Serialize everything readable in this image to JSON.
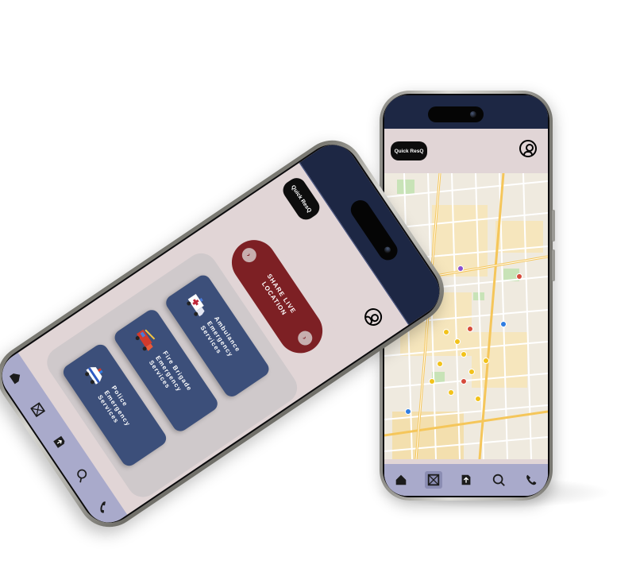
{
  "app": {
    "brand": "Quick ResQ"
  },
  "right_phone": {
    "header": {
      "brand_label": "Quick ResQ"
    },
    "map": {
      "markers": [
        {
          "color": "#f2c21a"
        },
        {
          "color": "#f2c21a"
        },
        {
          "color": "#f2c21a"
        },
        {
          "color": "#f2c21a"
        },
        {
          "color": "#f2c21a"
        },
        {
          "color": "#f2c21a"
        },
        {
          "color": "#f2c21a"
        },
        {
          "color": "#f2c21a"
        },
        {
          "color": "#f2c21a"
        },
        {
          "color": "#2f7de1"
        },
        {
          "color": "#2f7de1"
        },
        {
          "color": "#2f7de1"
        },
        {
          "color": "#8a4fd0"
        },
        {
          "color": "#8a4fd0"
        },
        {
          "color": "#d64b3b"
        },
        {
          "color": "#d64b3b"
        },
        {
          "color": "#d64b3b"
        },
        {
          "color": "#e86aa8"
        }
      ]
    },
    "nav": [
      {
        "icon": "home-icon"
      },
      {
        "icon": "map-icon",
        "active": true
      },
      {
        "icon": "upload-icon"
      },
      {
        "icon": "search-icon"
      },
      {
        "icon": "phone-icon"
      }
    ]
  },
  "left_phone": {
    "header": {
      "brand_label": "Quick ResQ"
    },
    "share_button": {
      "label": "SHARE LIVE LOCATION"
    },
    "services": [
      {
        "label": "Ambulance Emergency Services",
        "icon": "ambulance-icon"
      },
      {
        "label": "Fire Brigade Emergency Services",
        "icon": "fire-truck-icon"
      },
      {
        "label": "Police Emergency Services",
        "icon": "police-car-icon"
      }
    ],
    "nav": [
      {
        "icon": "home-icon"
      },
      {
        "icon": "map-icon"
      },
      {
        "icon": "upload-icon"
      },
      {
        "icon": "search-icon"
      },
      {
        "icon": "phone-icon"
      }
    ]
  },
  "colors": {
    "header_bg": "#e1d5d6",
    "status_band": "#1d2744",
    "nav_bg": "#a9aacb",
    "service_card": "#3c4f7a",
    "share_button": "#7d2024"
  }
}
